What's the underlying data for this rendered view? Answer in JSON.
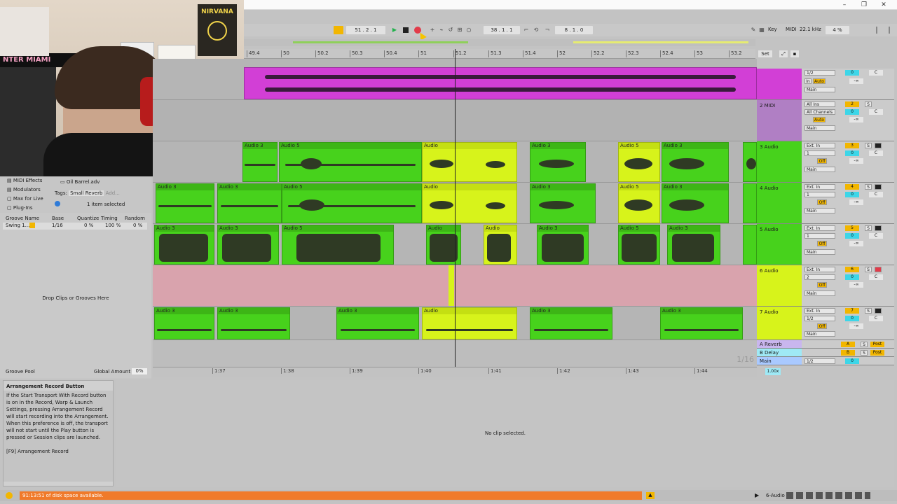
{
  "window": {
    "minimize": "–",
    "restore": "❐",
    "close": "✕"
  },
  "transport": {
    "arrangement_position": "51 .  2 .  1",
    "loop_start": "38 .  1 .  1",
    "loop_length": "8 .  1 .  0",
    "key_label": "Key",
    "midi_label": "MIDI",
    "sample_rate": "22.1 kHz",
    "cpu": "4 %"
  },
  "ruler": {
    "ticks": [
      "49.4",
      "50",
      "50.2",
      "50.3",
      "50.4",
      "51",
      "51.2",
      "51.3",
      "51.4",
      "52",
      "52.2",
      "52.3",
      "52.4",
      "53",
      "53.2"
    ]
  },
  "beat_time": {
    "ticks": [
      "1:37",
      "1:38",
      "1:39",
      "1:40",
      "1:41",
      "1:42",
      "1:43",
      "1:44"
    ],
    "grid": "1/16"
  },
  "set_button": "Set",
  "tracks": [
    {
      "name": "",
      "color": "#d23fd6",
      "number": "1",
      "input": "1/2",
      "monitor": "Auto",
      "routing": "Main",
      "type": "audio",
      "volume": "0",
      "pan": "C",
      "db": "-∞"
    },
    {
      "name": "2 MIDI",
      "color": "#b07fc4",
      "number": "2",
      "input": "All Ins",
      "channel": "All Channels",
      "monitor": "Auto",
      "routing": "Main",
      "volume": "0",
      "pan": "C",
      "db": "-∞"
    },
    {
      "name": "3 Audio",
      "color": "#47d21c",
      "number": "3",
      "input": "Ext. In",
      "channel": "1",
      "monitor": "Off",
      "routing": "Main",
      "volume": "0",
      "pan": "C",
      "db": "-∞"
    },
    {
      "name": "4 Audio",
      "color": "#47d21c",
      "number": "4",
      "input": "Ext. In",
      "channel": "1",
      "monitor": "Off",
      "routing": "Main",
      "volume": "0",
      "pan": "C",
      "db": "-∞"
    },
    {
      "name": "5 Audio",
      "color": "#47d21c",
      "number": "5",
      "input": "Ext. In",
      "channel": "1",
      "monitor": "Off",
      "routing": "Main",
      "volume": "0",
      "pan": "C",
      "db": "-∞"
    },
    {
      "name": "6 Audio",
      "color": "#d7f31b",
      "number": "6",
      "input": "Ext. In",
      "channel": "2",
      "monitor": "Off",
      "routing": "Main",
      "volume": "0",
      "pan": "C",
      "db": "-∞"
    },
    {
      "name": "7 Audio",
      "color": "#d7f31b",
      "number": "7",
      "input": "Ext. In",
      "channel": "1/2",
      "monitor": "Off",
      "routing": "Main",
      "volume": "0",
      "pan": "C",
      "db": "-∞"
    }
  ],
  "returns": [
    {
      "name": "A Reverb",
      "letter": "A",
      "post": "Post"
    },
    {
      "name": "B Delay",
      "letter": "B",
      "post": "Post"
    },
    {
      "name": "Main",
      "routing": "1/2",
      "volume": "0"
    }
  ],
  "clip_labels": {
    "audio3": "Audio 3",
    "audio5": "Audio 5",
    "audio": "Audio",
    "aud": "Aud",
    "in": "In",
    "s": "S",
    "c": "C"
  },
  "zoom": "1.00x",
  "browser": {
    "items": [
      "MIDI Effects",
      "Modulators",
      "Max for Live",
      "Plug-Ins"
    ],
    "file": "Oil Barrel.adv",
    "tags_label": "Tags:",
    "tag": "Small Reverb",
    "add": "Add...",
    "selection": "1 item selected"
  },
  "groove": {
    "headers": [
      "Groove Name",
      "Base",
      "Quantize",
      "Timing",
      "Random"
    ],
    "row": {
      "name": "Swing 1...",
      "base": "1/16",
      "quantize": "0 %",
      "timing": "100 %",
      "random": "0 %"
    },
    "drop_hint": "Drop Clips or Grooves Here",
    "pool_label": "Groove Pool",
    "global_amount_label": "Global Amount",
    "global_amount": "0%"
  },
  "info": {
    "title": "Arrangement Record Button",
    "body": "If the Start Transport With Record button is on in the Record, Warp & Launch Settings, pressing Arrangement Record will start recording into the Arrangement. When this preference is off, the transport will not start until the Play button is pressed or Session clips are launched.",
    "shortcut": "[F9] Arrangement Record"
  },
  "detail": {
    "empty": "No clip selected."
  },
  "status": {
    "disk": "91:13:51 of disk space available.",
    "track": "6-Audio"
  },
  "webcam": {
    "poster": "NIRVANA",
    "banner": "NTER MIAMI"
  },
  "colors": {
    "green": "#47d21c",
    "lime": "#d7f31b",
    "magenta": "#d23fd6",
    "pink": "#d9a3ad",
    "orange": "#f07a2a",
    "accent": "#f2b600"
  }
}
